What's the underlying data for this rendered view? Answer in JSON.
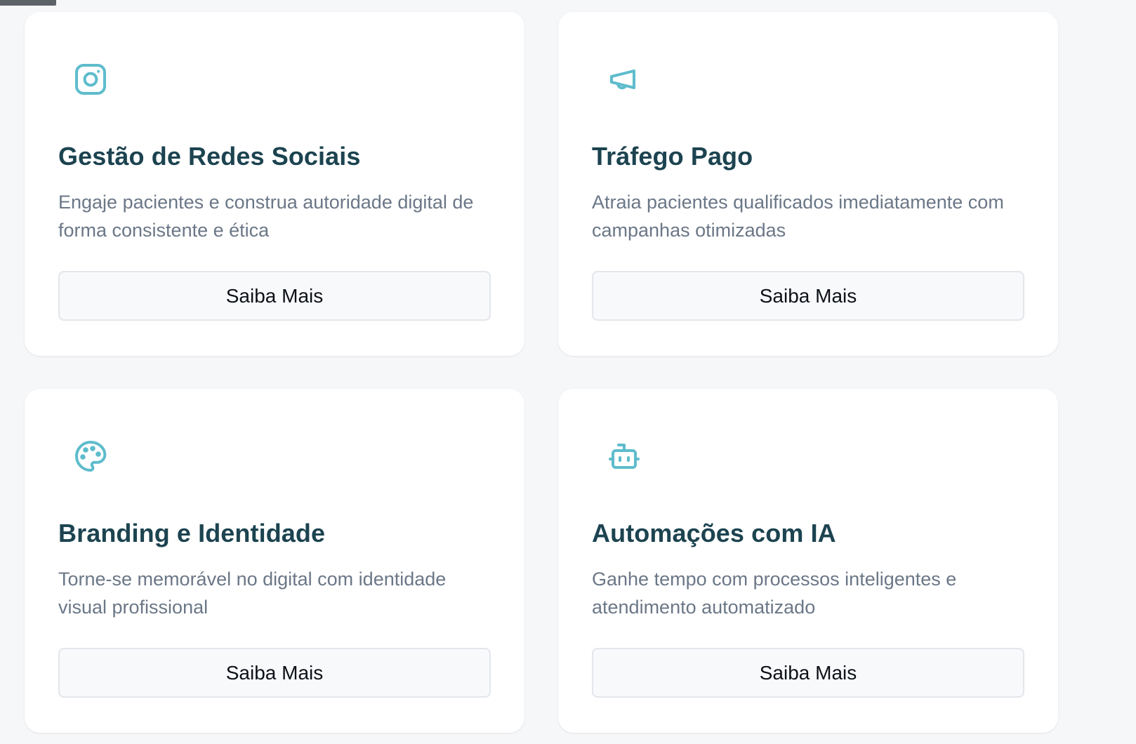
{
  "colors": {
    "page_background": "#f6f7f9",
    "card_background": "#ffffff",
    "title": "#1c4350",
    "description": "#6b7787",
    "icon_accent": "#5ebccc",
    "button_background": "#f8f9fb",
    "button_border": "#e3e6eb"
  },
  "cards": [
    {
      "icon": "instagram-icon",
      "title": "Gestão de Redes Sociais",
      "description": "Engaje pacientes e construa autoridade digital de forma consistente e ética",
      "button_label": "Saiba Mais"
    },
    {
      "icon": "megaphone-icon",
      "title": "Tráfego Pago",
      "description": "Atraia pacientes qualificados imediatamente com campanhas otimizadas",
      "button_label": "Saiba Mais"
    },
    {
      "icon": "palette-icon",
      "title": "Branding e Identidade",
      "description": "Torne-se memorável no digital com identidade visual profissional",
      "button_label": "Saiba Mais"
    },
    {
      "icon": "bot-icon",
      "title": "Automações com IA",
      "description": "Ganhe tempo com processos inteligentes e atendimento automatizado",
      "button_label": "Saiba Mais"
    }
  ]
}
